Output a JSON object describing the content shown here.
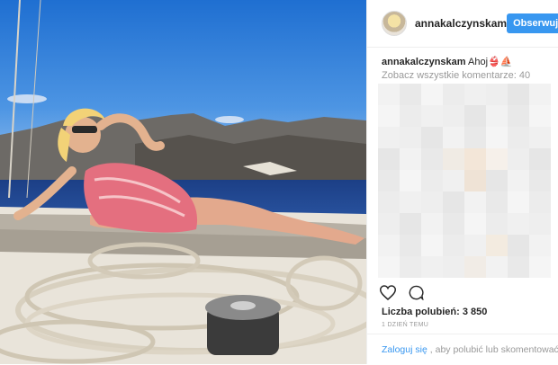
{
  "post": {
    "username": "annakalczynskam",
    "follow_label": "Obserwuj",
    "caption_user": "annakalczynskam",
    "caption_text": "Ahoj👙⛵",
    "view_all_comments": "Zobacz wszystkie komentarze: 40",
    "likes": "Liczba polubień: 3 850",
    "timestamp": "1 DZIEŃ TEMU",
    "login_link": "Zaloguj się",
    "login_suffix": ", aby polubić lub skomentować."
  },
  "icons": {
    "like": "heart-icon",
    "comment": "comment-icon"
  },
  "colors": {
    "accent": "#3897f0",
    "muted": "#999999",
    "text": "#262626"
  }
}
